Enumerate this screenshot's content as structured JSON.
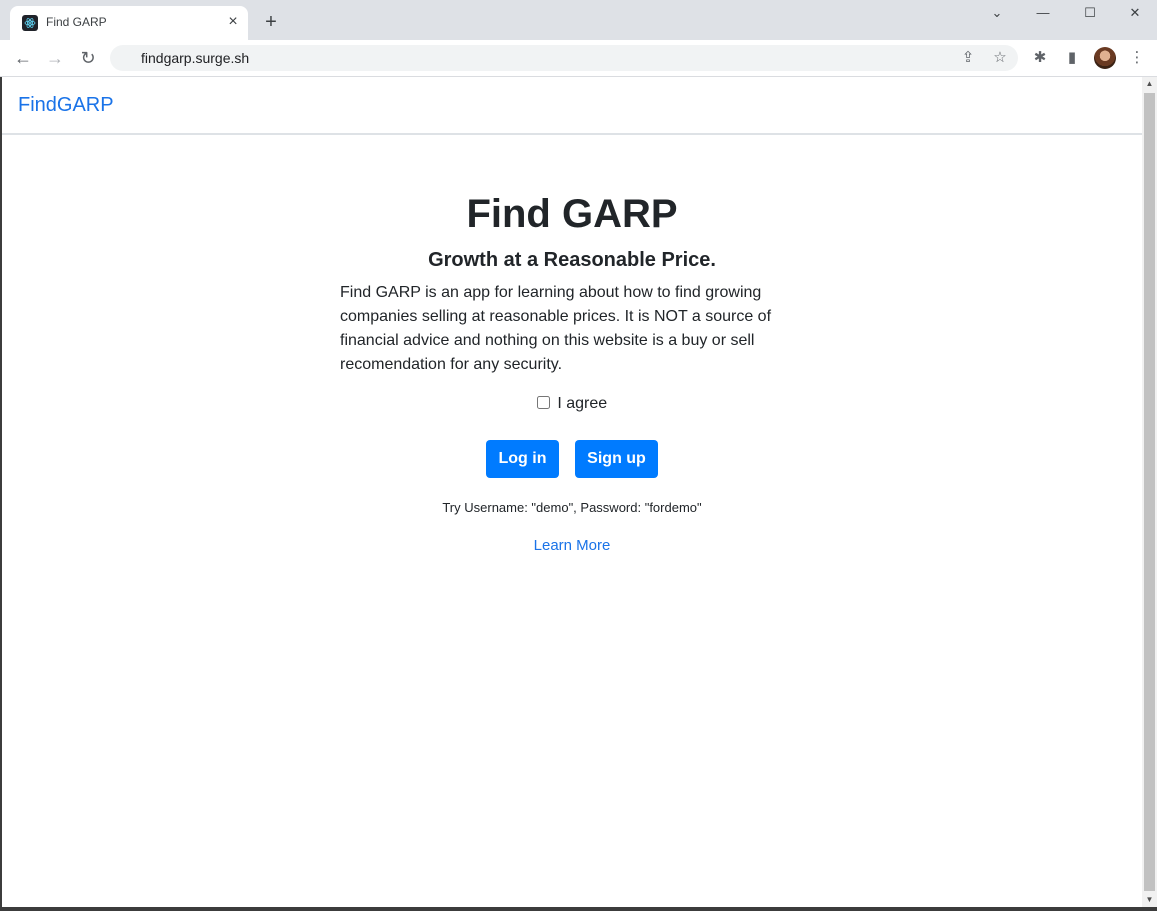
{
  "browser": {
    "tab_title": "Find GARP",
    "tab_close": "×",
    "new_tab": "+",
    "address": "findgarp.surge.sh",
    "window_controls": {
      "chevron": "⌄",
      "minimize": "—",
      "maximize": "☐",
      "close": "✕"
    },
    "nav": {
      "back": "←",
      "forward": "→",
      "reload": "↻"
    },
    "icons": {
      "share": "⇪",
      "bookmark": "☆",
      "extensions": "✱",
      "sidepanel": "▮",
      "menu": "⋮"
    }
  },
  "navbar": {
    "brand": "FindGARP"
  },
  "main": {
    "title": "Find GARP",
    "subtitle": "Growth at a Reasonable Price.",
    "description": "Find GARP is an app for learning about how to find growing companies selling at reasonable prices. It is NOT a source of financial advice and nothing on this website is a buy or sell recomendation for any security.",
    "agree_label": "I agree",
    "agree_checked": false,
    "login_label": "Log in",
    "signup_label": "Sign up",
    "hint": "Try Username: \"demo\", Password: \"fordemo\"",
    "learn_more": "Learn More"
  },
  "colors": {
    "primary": "#007bff",
    "link": "#1a73e8",
    "text": "#212529"
  }
}
